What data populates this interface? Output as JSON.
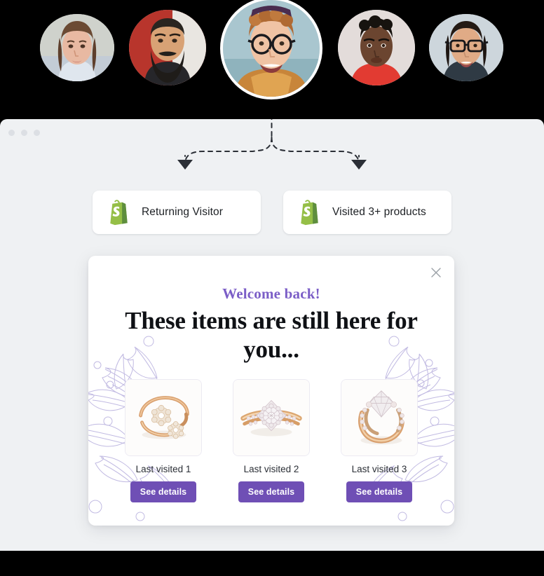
{
  "colors": {
    "accent_purple": "#6f4fb5",
    "eyebrow_purple": "#7b5ec7",
    "shopify_green_light": "#95BF47",
    "shopify_green_dark": "#5E8E3E",
    "browser_bg": "#eff1f3",
    "floral_line": "#b6aedd"
  },
  "avatars": [
    {
      "name": "avatar-visitor-1",
      "alt": "Young woman with long brown hair"
    },
    {
      "name": "avatar-visitor-2",
      "alt": "Bearded man in dark shirt on red background"
    },
    {
      "name": "avatar-visitor-3",
      "alt": "Smiling young man with glasses and beanie"
    },
    {
      "name": "avatar-visitor-4",
      "alt": "Young man in red t-shirt"
    },
    {
      "name": "avatar-visitor-5",
      "alt": "Young woman with glasses smiling"
    }
  ],
  "browser": {
    "window_dots": [
      "dot-1",
      "dot-2",
      "dot-3"
    ]
  },
  "conditions": [
    {
      "icon": "shopify-icon",
      "label": "Returning Visitor"
    },
    {
      "icon": "shopify-icon",
      "label": "Visited 3+ products"
    }
  ],
  "popup": {
    "close_label": "×",
    "eyebrow": "Welcome back!",
    "headline": "These items are still here for you...",
    "products": [
      {
        "name": "Last visited 1",
        "image": "gold-bypass-ring",
        "cta": "See details"
      },
      {
        "name": "Last visited 2",
        "image": "halo-diamond-ring",
        "cta": "See details"
      },
      {
        "name": "Last visited 3",
        "image": "solitaire-diamond-ring",
        "cta": "See details"
      }
    ]
  }
}
